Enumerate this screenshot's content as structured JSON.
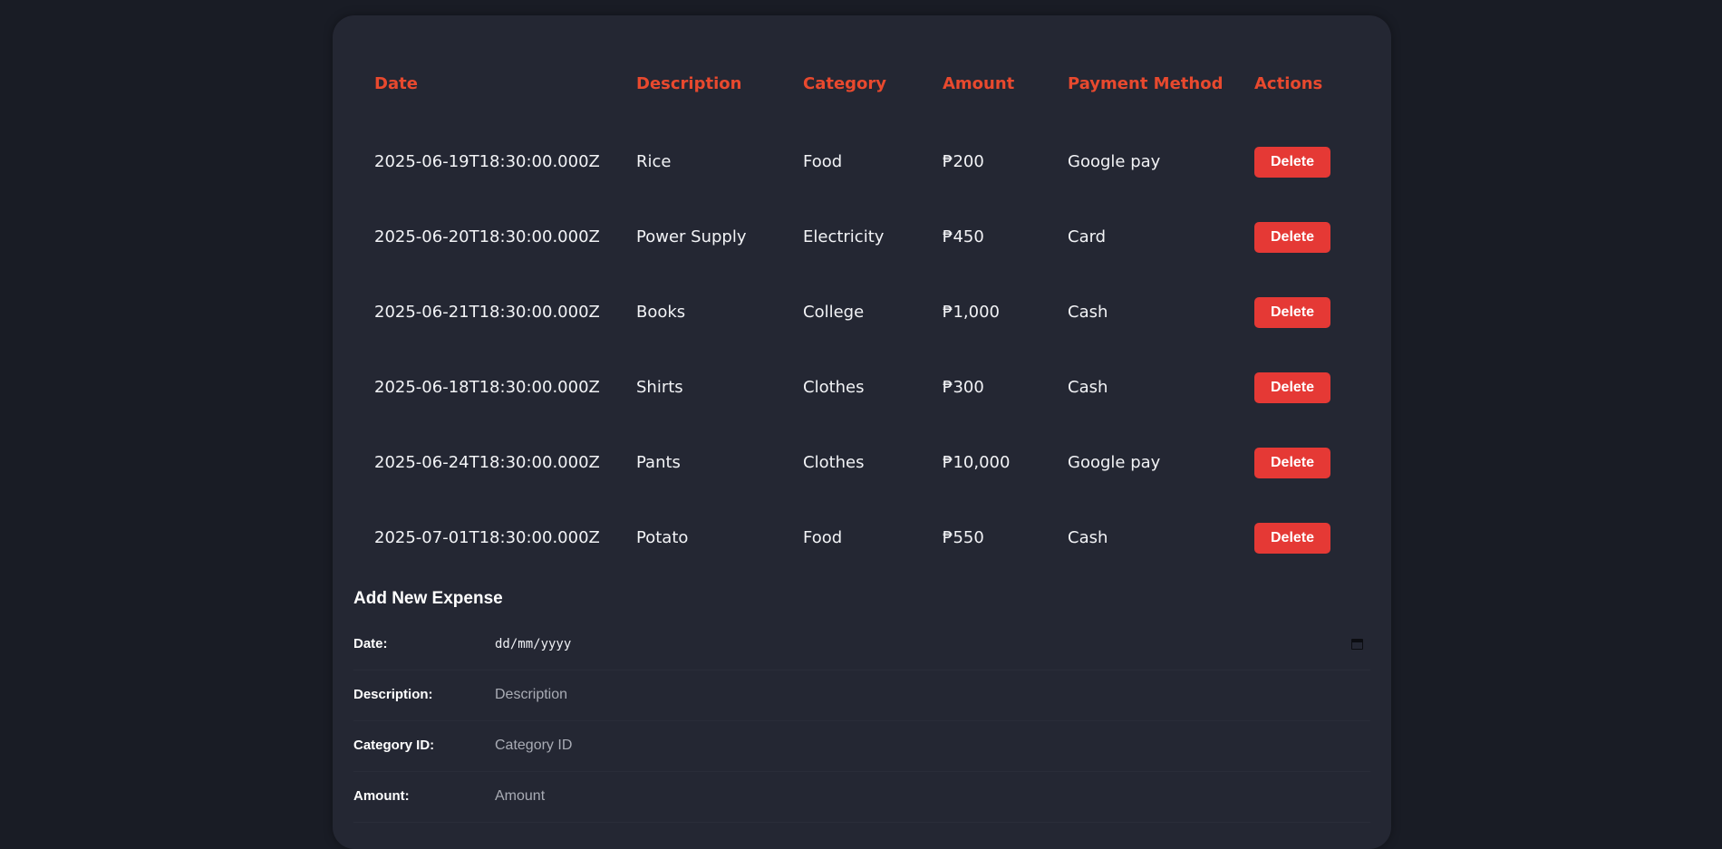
{
  "table": {
    "headers": {
      "date": "Date",
      "description": "Description",
      "category": "Category",
      "amount": "Amount",
      "payment_method": "Payment Method",
      "actions": "Actions"
    },
    "rows": [
      {
        "date": "2025-06-19T18:30:00.000Z",
        "description": "Rice",
        "category": "Food",
        "amount": "₱200",
        "payment_method": "Google pay",
        "action_label": "Delete"
      },
      {
        "date": "2025-06-20T18:30:00.000Z",
        "description": "Power Supply",
        "category": "Electricity",
        "amount": "₱450",
        "payment_method": "Card",
        "action_label": "Delete"
      },
      {
        "date": "2025-06-21T18:30:00.000Z",
        "description": "Books",
        "category": "College",
        "amount": "₱1,000",
        "payment_method": "Cash",
        "action_label": "Delete"
      },
      {
        "date": "2025-06-18T18:30:00.000Z",
        "description": "Shirts",
        "category": "Clothes",
        "amount": "₱300",
        "payment_method": "Cash",
        "action_label": "Delete"
      },
      {
        "date": "2025-06-24T18:30:00.000Z",
        "description": "Pants",
        "category": "Clothes",
        "amount": "₱10,000",
        "payment_method": "Google pay",
        "action_label": "Delete"
      },
      {
        "date": "2025-07-01T18:30:00.000Z",
        "description": "Potato",
        "category": "Food",
        "amount": "₱550",
        "payment_method": "Cash",
        "action_label": "Delete"
      }
    ]
  },
  "form": {
    "title": "Add New Expense",
    "date": {
      "label": "Date:",
      "value_display": "dd/mm/yyyy",
      "icon": "calendar-icon"
    },
    "description": {
      "label": "Description:",
      "placeholder": "Description"
    },
    "category_id": {
      "label": "Category ID:",
      "placeholder": "Category ID"
    },
    "amount": {
      "label": "Amount:",
      "placeholder": "Amount"
    }
  },
  "colors": {
    "page_background": "#191c25",
    "card_background": "#242733",
    "header_accent": "#e8492e",
    "delete_button": "#e53935",
    "text": "#eef0f4"
  }
}
